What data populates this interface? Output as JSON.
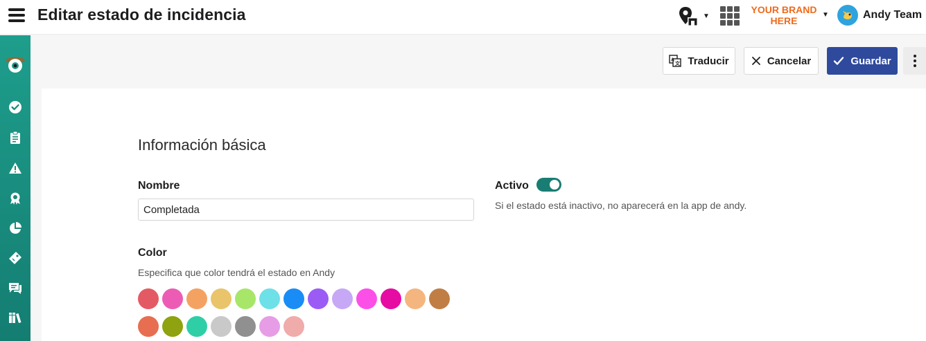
{
  "header": {
    "title": "Editar estado de incidencia",
    "brand_line1": "YOUR BRAND",
    "brand_line2": "HERE",
    "user_name": "Andy Team",
    "icons": [
      "menu-icon",
      "location-store-icon",
      "apps-grid-icon",
      "caret-down-icon",
      "avatar-icon"
    ]
  },
  "sidebar": {
    "items": [
      {
        "icon": "check-circle-icon"
      },
      {
        "icon": "clipboard-icon"
      },
      {
        "icon": "warning-icon"
      },
      {
        "icon": "award-icon"
      },
      {
        "icon": "pie-chart-icon"
      },
      {
        "icon": "tag-icon"
      },
      {
        "icon": "chat-icon"
      },
      {
        "icon": "library-icon"
      }
    ]
  },
  "toolbar": {
    "translate_label": "Traducir",
    "cancel_label": "Cancelar",
    "save_label": "Guardar"
  },
  "form": {
    "section_title": "Información básica",
    "name_label": "Nombre",
    "name_value": "Completada",
    "active_label": "Activo",
    "active_value": true,
    "active_help": "Si el estado está inactivo, no aparecerá en la app de andy.",
    "color_label": "Color",
    "color_help": "Especifica que color tendrá el estado en Andy",
    "colors": [
      "#e45a64",
      "#ec5cb4",
      "#f4a262",
      "#e9c46a",
      "#a8e66a",
      "#6ee0e8",
      "#1a8cf5",
      "#9b5cf5",
      "#c7a8f7",
      "#fb4fe8",
      "#e60ba3",
      "#f4b67e",
      "#c07e45",
      "#e76e50",
      "#8fa20f",
      "#2ecfa6",
      "#c9c9c9",
      "#909090",
      "#e69de6",
      "#f0abab"
    ]
  },
  "colors": {
    "accent": "#2f4a9d",
    "sidebar": "#1e9e8c",
    "toggle": "#1a7d74",
    "brand": "#ef6a1b"
  }
}
